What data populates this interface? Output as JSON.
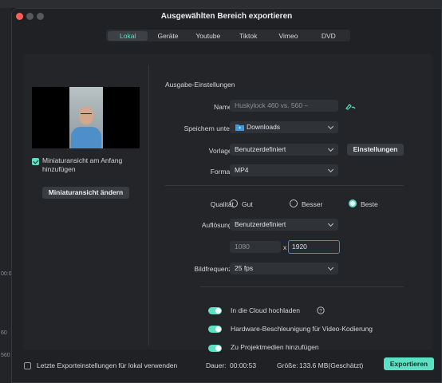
{
  "window": {
    "title": "Ausgewählten Bereich exportieren"
  },
  "tabs": [
    {
      "label": "Lokal",
      "active": true
    },
    {
      "label": "Geräte"
    },
    {
      "label": "Youtube"
    },
    {
      "label": "Tiktok"
    },
    {
      "label": "Vimeo"
    },
    {
      "label": "DVD"
    }
  ],
  "left": {
    "thumbnail_checkbox_label": "Miniaturansicht am Anfang",
    "thumbnail_checkbox_label2": "hinzufügen",
    "change_thumbnail_button": "Miniaturansicht ändern"
  },
  "settings": {
    "section_title": "Ausgabe-Einstellungen",
    "name_label": "Name:",
    "name_value": "Huskylock 460 vs. 560 –",
    "save_label": "Speichern unter:",
    "save_value": "Downloads",
    "template_label": "Vorlage:",
    "template_value": "Benutzerdefiniert",
    "settings_button": "Einstellungen",
    "format_label": "Format:",
    "format_value": "MP4",
    "quality_label": "Qualität",
    "quality_options": [
      "Gut",
      "Besser",
      "Beste"
    ],
    "quality_selected": "Beste",
    "resolution_label": "Auflösung:",
    "resolution_value": "Benutzerdefiniert",
    "width_value": "1080",
    "x_separator": "x",
    "height_value": "1920",
    "framerate_label": "Bildfrequenz:",
    "framerate_value": "25 fps"
  },
  "toggles": [
    {
      "label": "In die Cloud hochladen",
      "on": true
    },
    {
      "label": "Hardware-Beschleunigung für Video-Kodierung",
      "on": true
    },
    {
      "label": "Zu Projektmedien hinzufügen",
      "on": true
    }
  ],
  "footer": {
    "remember_label": "Letzte Exporteinstellungen für lokal verwenden",
    "duration_label": "Dauer:",
    "duration_value": "00:00:53",
    "size_label": "Größe:",
    "size_value": "133.6 MB(Geschätzt)",
    "export_button": "Exportieren"
  },
  "background": {
    "frag1": "00:0",
    "frag2": "60",
    "frag3": "560"
  },
  "colors": {
    "accent": "#5be0c4",
    "window_bg": "#1f2124",
    "panel_bg": "#232528"
  }
}
